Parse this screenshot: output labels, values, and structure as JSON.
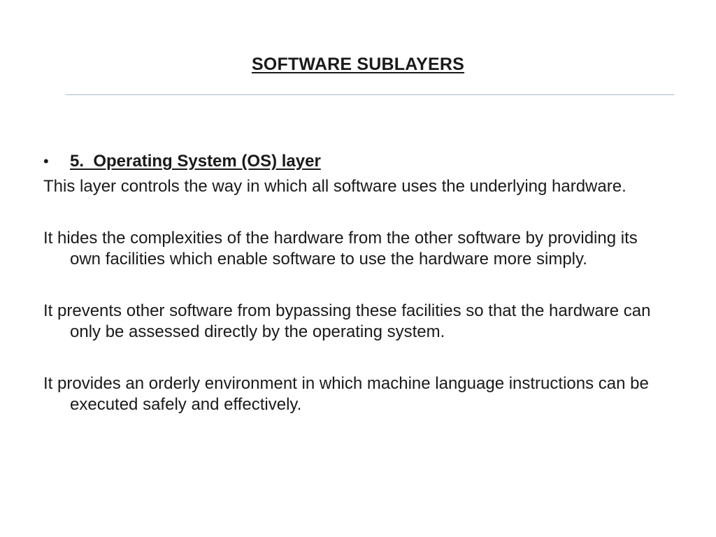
{
  "slide": {
    "title": "SOFTWARE SUBLAYERS",
    "bullet": {
      "symbol": "•",
      "text": "5.  Operating System (OS) layer"
    },
    "paragraphs": [
      "This layer controls the way in which all software uses the underlying hardware.",
      "It hides the complexities of the hardware from the other software by providing its own facilities which enable software to use the hardware more simply.",
      "It prevents other software from bypassing these facilities so that  the hardware can only be assessed directly by the operating system.",
      "It provides an orderly environment in which machine language instructions can be executed safely and effectively."
    ]
  },
  "colors": {
    "rule": "#a7bccb",
    "text": "#1a1a1a",
    "background": "#ffffff"
  }
}
